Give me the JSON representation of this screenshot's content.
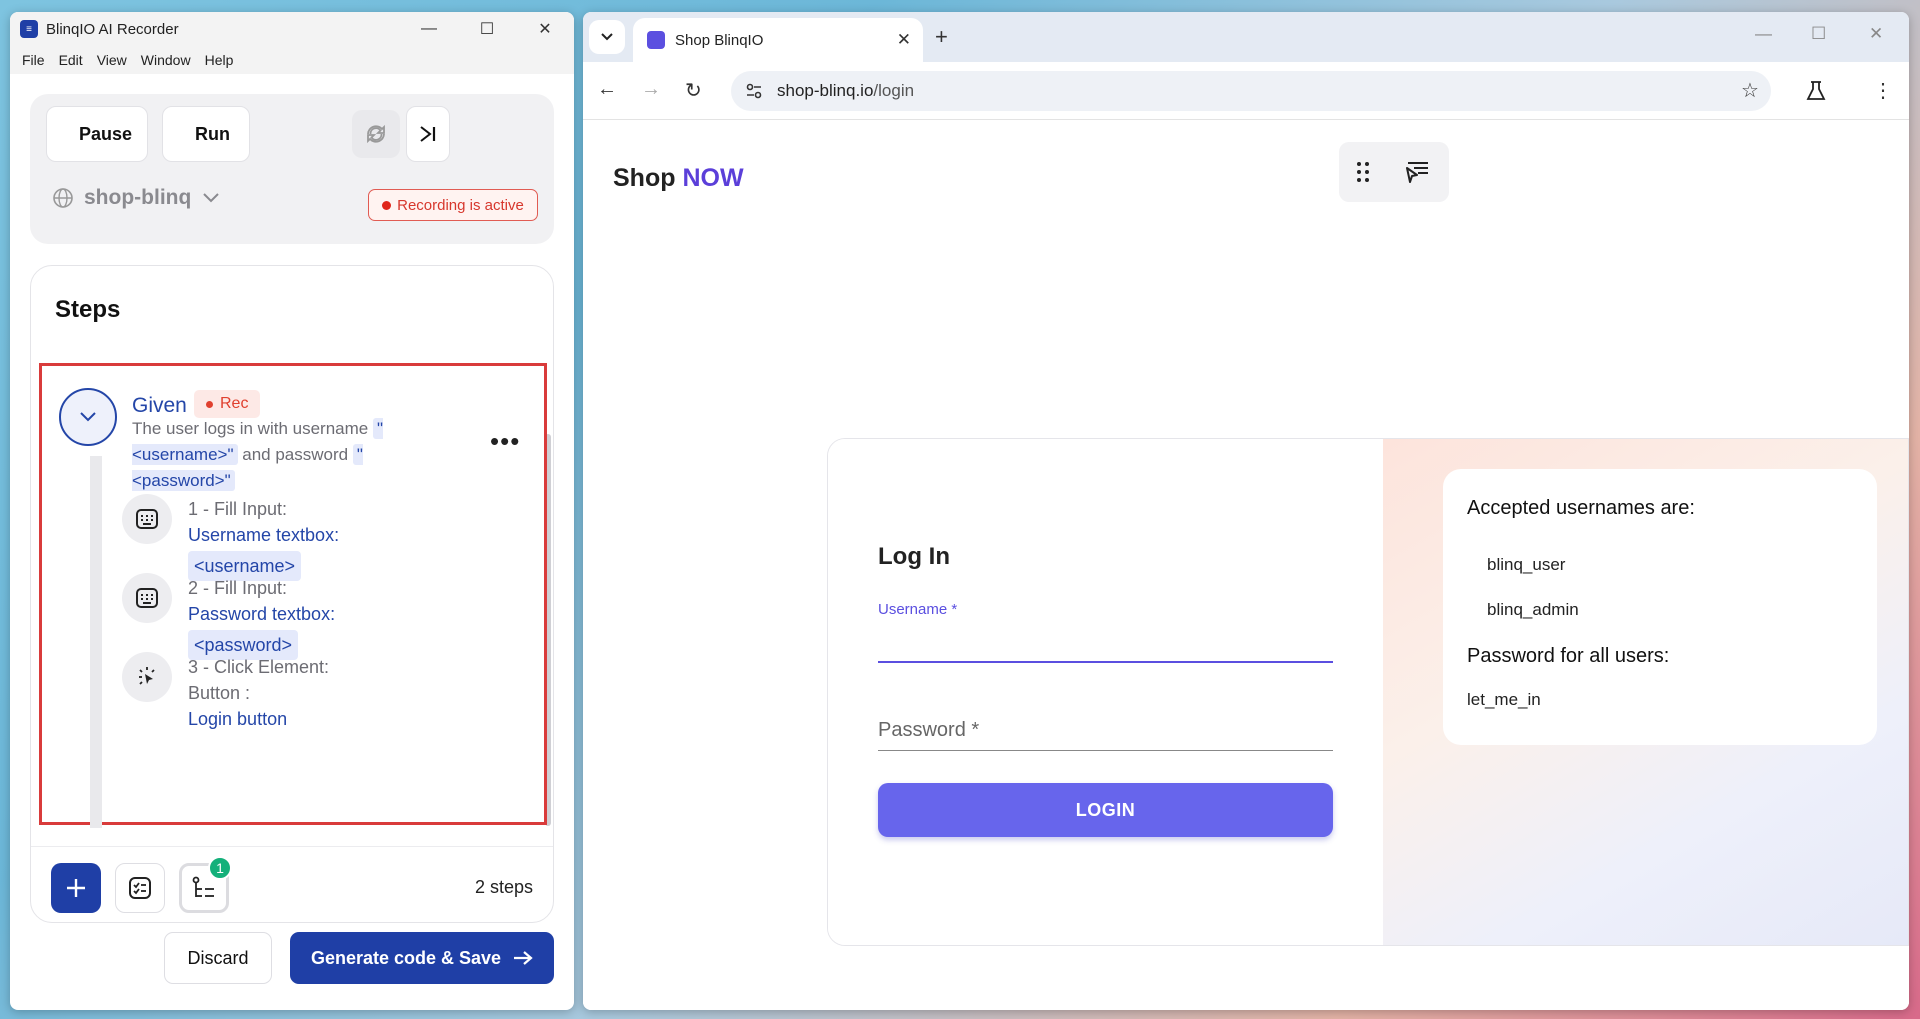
{
  "recorder": {
    "title": "BlinqIO AI Recorder",
    "menu": [
      "File",
      "Edit",
      "View",
      "Window",
      "Help"
    ],
    "pause_label": "Pause",
    "run_label": "Run",
    "project": "shop-blinq",
    "recording_status": "Recording is active",
    "steps_title": "Steps",
    "given": {
      "keyword": "Given",
      "badge": "Rec",
      "text_before": "The user logs in with username",
      "param1": "\"<username>\"",
      "text_mid": "and password",
      "param2": "\"<password>\""
    },
    "steps": [
      {
        "num": "1 - Fill Input:",
        "target": "Username textbox:",
        "value": "<username>"
      },
      {
        "num": "2 - Fill Input:",
        "target": "Password textbox:",
        "value": "<password>"
      },
      {
        "num": "3 - Click Element:",
        "type": "Button :",
        "target": "Login button"
      }
    ],
    "badge_count": "1",
    "steps_count": "2 steps",
    "discard_label": "Discard",
    "generate_label": "Generate code & Save"
  },
  "browser": {
    "tab_title": "Shop BlinqIO",
    "url_host": "shop-blinq.io",
    "url_path": "/login",
    "brand_prefix": "Shop",
    "brand_accent": "NOW",
    "login_heading": "Log In",
    "username_label": "Username *",
    "password_placeholder": "Password *",
    "login_button": "LOGIN",
    "info_heading_users": "Accepted usernames are:",
    "usernames": [
      "blinq_user",
      "blinq_admin"
    ],
    "info_heading_password": "Password for all users:",
    "password": "let_me_in"
  },
  "colors": {
    "primary": "#1f3fa6",
    "accent": "#6765ec",
    "recording": "#e0261b"
  }
}
